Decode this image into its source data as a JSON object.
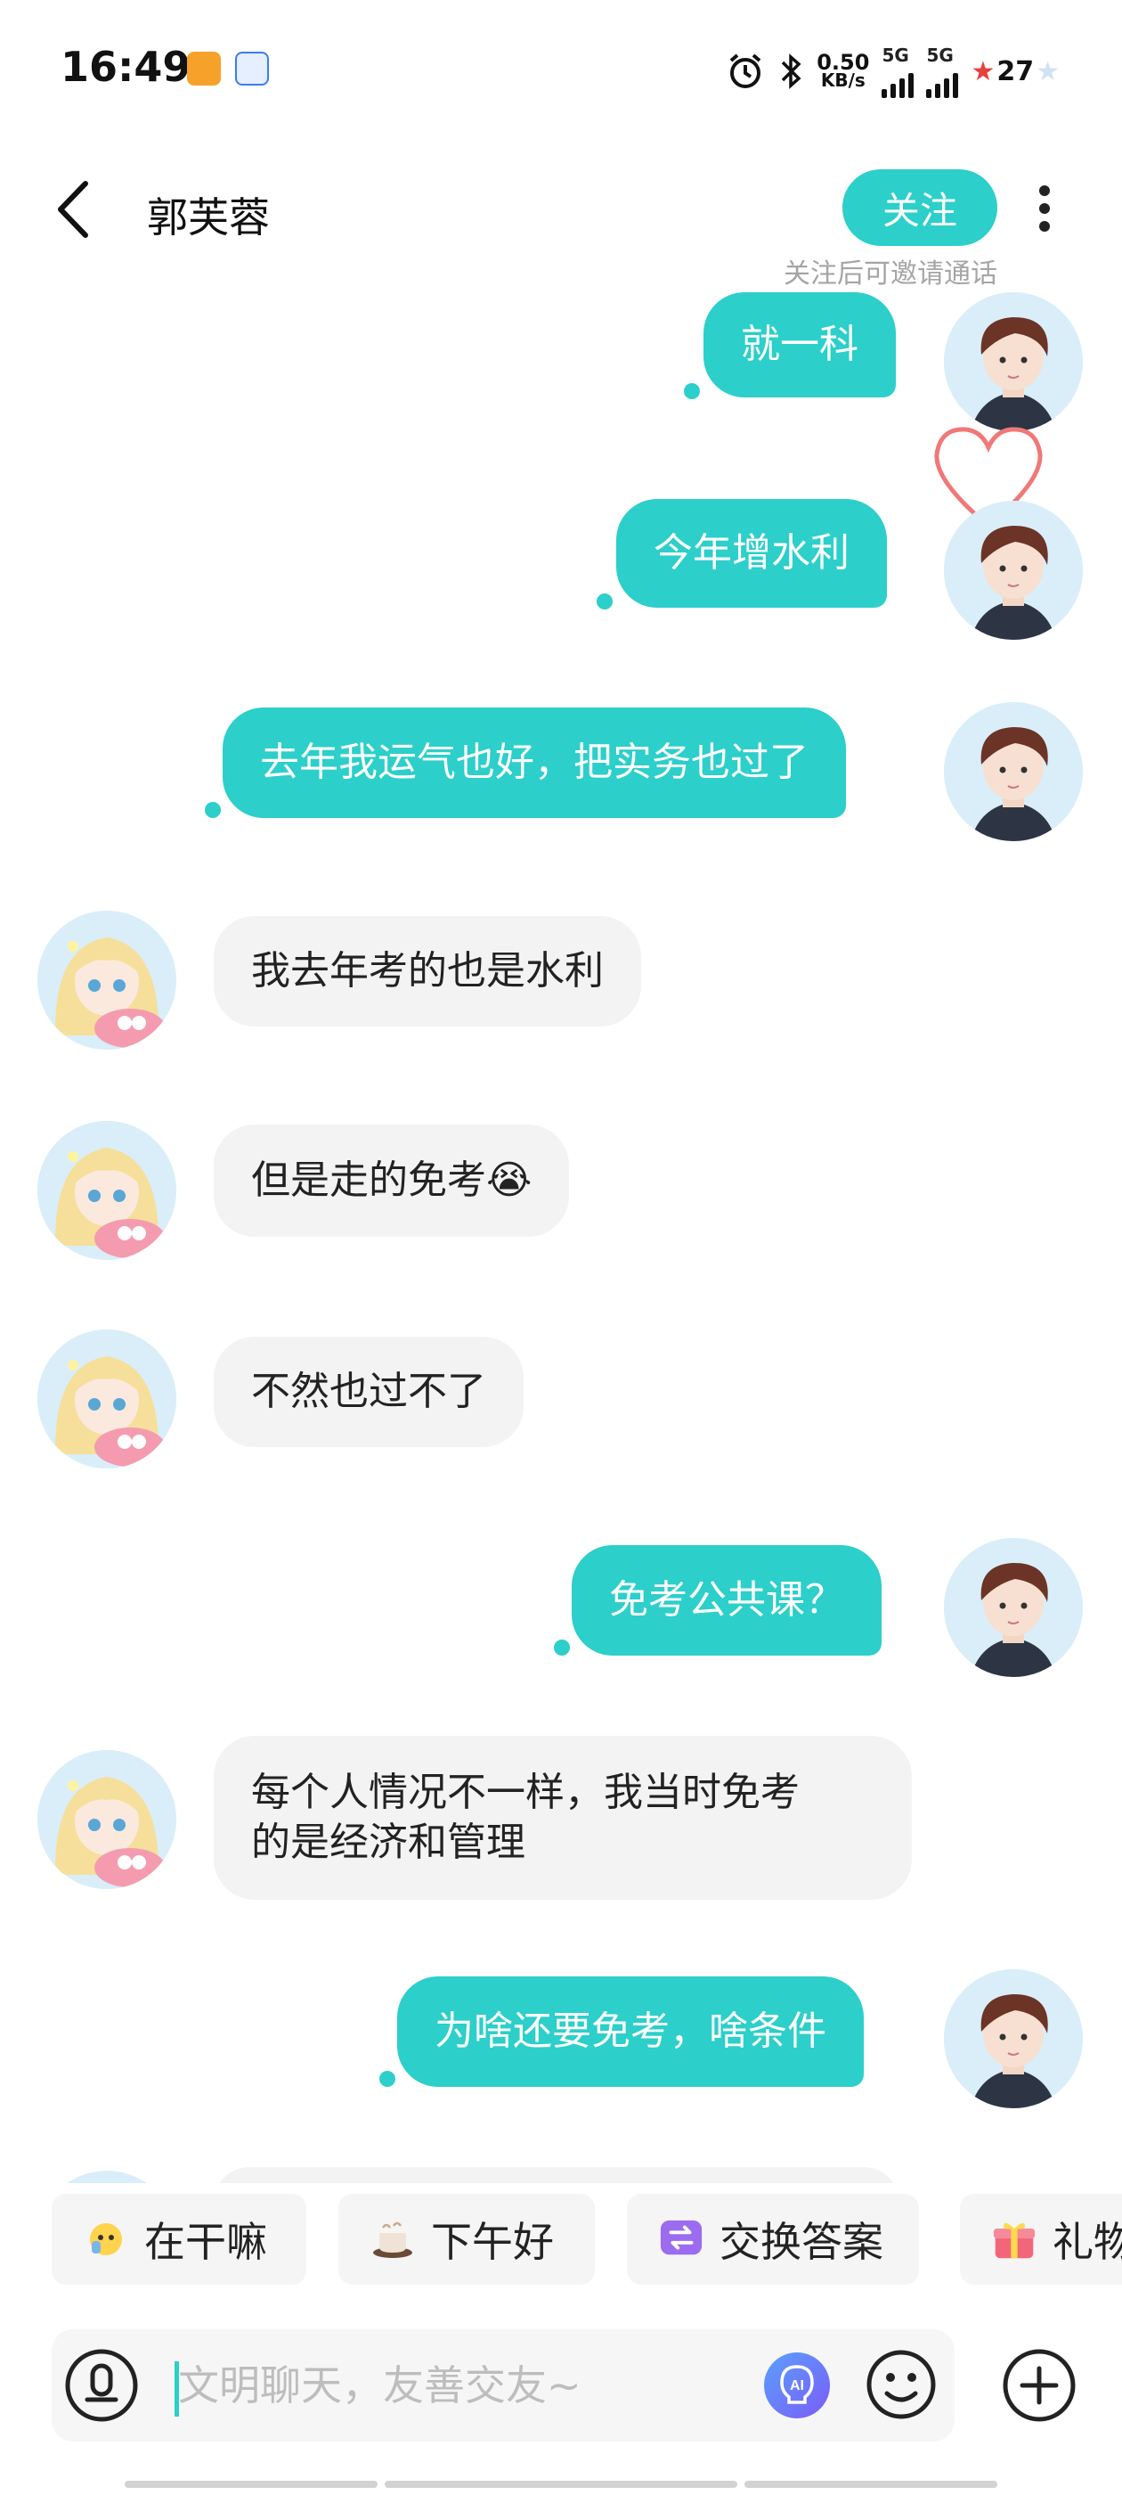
{
  "status_bar": {
    "time": "16:49",
    "net_speed_value": "0.50",
    "net_speed_unit": "KB/s",
    "sim1": "5G",
    "sim2": "5G",
    "battery": "27"
  },
  "header": {
    "title": "郭芙蓉",
    "follow_label": "关注",
    "follow_hint": "关注后可邀请通话"
  },
  "messages": [
    {
      "side": "out",
      "text": "就一科"
    },
    {
      "side": "out",
      "text": "今年增水利"
    },
    {
      "side": "out",
      "text": "去年我运气也好，把实务也过了"
    },
    {
      "side": "in",
      "text": "我去年考的也是水利"
    },
    {
      "side": "in",
      "text": "但是走的免考😭"
    },
    {
      "side": "in",
      "text": "不然也过不了"
    },
    {
      "side": "out",
      "text": "免考公共课？"
    },
    {
      "side": "in",
      "text_line1": "每个人情况不一样，我当时免考",
      "text_line2": "的是经济和管理"
    },
    {
      "side": "out",
      "text": "为啥还要免考，啥条件"
    }
  ],
  "quick_replies": [
    {
      "label": "在干嘛",
      "icon": "face-emoji-icon"
    },
    {
      "label": "下午好",
      "icon": "coffee-icon"
    },
    {
      "label": "交换答案",
      "icon": "exchange-icon"
    },
    {
      "label": "礼物",
      "icon": "gift-icon"
    }
  ],
  "input": {
    "placeholder": "文明聊天，友善交友~"
  },
  "colors": {
    "accent": "#2ccfca",
    "incoming_bubble": "#f3f3f3"
  }
}
